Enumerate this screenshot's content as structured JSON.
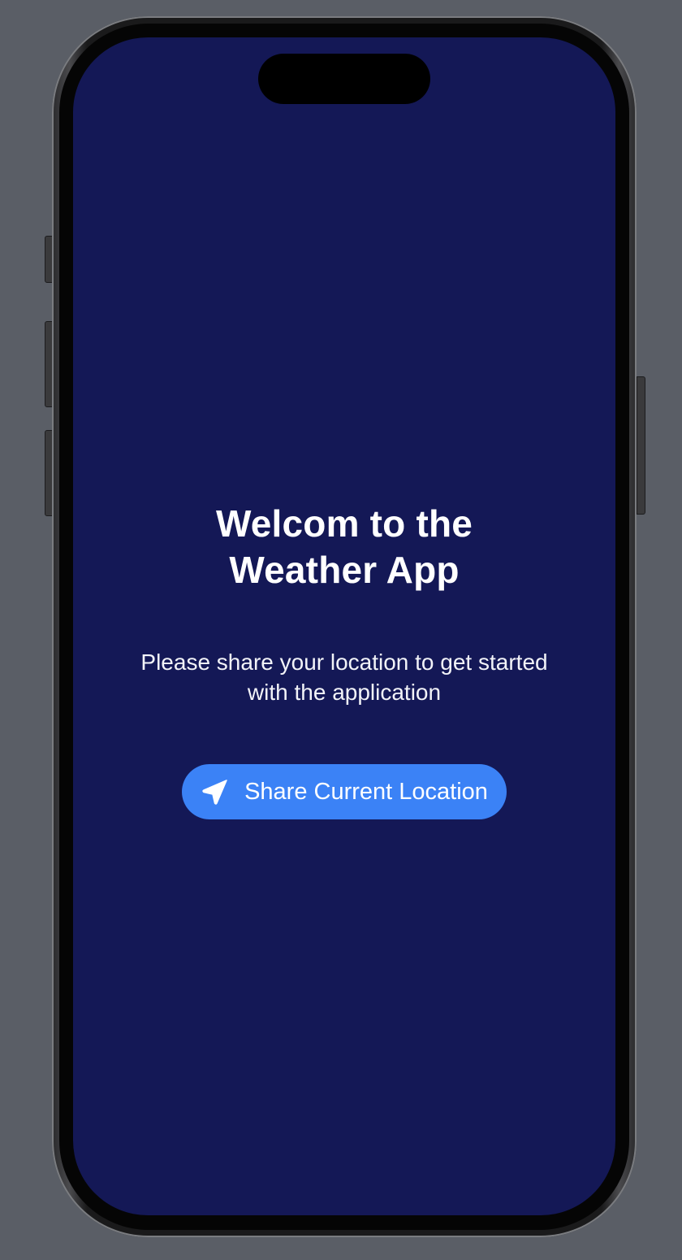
{
  "welcome": {
    "title": "Welcom to the Weather App",
    "subtitle": "Please share your location to get started with the application",
    "share_button_label": "Share Current Location",
    "share_button_icon": "location-arrow-icon"
  },
  "colors": {
    "screen_background": "#141856",
    "button_background": "#3b82f6",
    "text": "#ffffff"
  }
}
